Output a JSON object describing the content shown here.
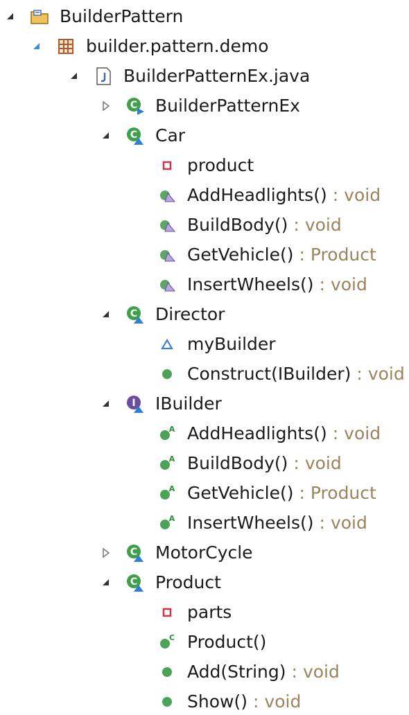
{
  "tree": {
    "nodes": [
      {
        "id": "project",
        "label": "BuilderPattern",
        "icon": "project-folder-icon",
        "expanded": true
      },
      {
        "id": "package",
        "label": "builder.pattern.demo",
        "icon": "package-icon",
        "expanded": true
      },
      {
        "id": "java_file",
        "label": "BuilderPatternEx.java",
        "icon": "java-file-icon",
        "expanded": true
      },
      {
        "id": "builderpatternex",
        "label": "BuilderPatternEx",
        "icon": "runnable-class-icon",
        "expanded": false
      },
      {
        "id": "car",
        "label": "Car",
        "icon": "class-icon",
        "expanded": true
      },
      {
        "id": "car_product",
        "label": "product",
        "icon": "private-field-icon"
      },
      {
        "id": "car_addheadlights",
        "label": "AddHeadlights()",
        "type": "void",
        "icon": "method-icon"
      },
      {
        "id": "car_buildbody",
        "label": "BuildBody()",
        "type": "void",
        "icon": "method-icon"
      },
      {
        "id": "car_getvehicle",
        "label": "GetVehicle()",
        "type": "Product",
        "icon": "method-icon"
      },
      {
        "id": "car_insertwheels",
        "label": "InsertWheels()",
        "type": "void",
        "icon": "method-icon"
      },
      {
        "id": "director",
        "label": "Director",
        "icon": "class-icon",
        "expanded": true
      },
      {
        "id": "director_mybuilder",
        "label": "myBuilder",
        "icon": "default-field-icon"
      },
      {
        "id": "director_construct",
        "label": "Construct(IBuilder)",
        "type": "void",
        "icon": "public-method-icon"
      },
      {
        "id": "ibuilder",
        "label": "IBuilder",
        "icon": "interface-icon",
        "expanded": true
      },
      {
        "id": "ib_addheadlights",
        "label": "AddHeadlights()",
        "type": "void",
        "icon": "abstract-method-icon"
      },
      {
        "id": "ib_buildbody",
        "label": "BuildBody()",
        "type": "void",
        "icon": "abstract-method-icon"
      },
      {
        "id": "ib_getvehicle",
        "label": "GetVehicle()",
        "type": "Product",
        "icon": "abstract-method-icon"
      },
      {
        "id": "ib_insertwheels",
        "label": "InsertWheels()",
        "type": "void",
        "icon": "abstract-method-icon"
      },
      {
        "id": "motorcycle",
        "label": "MotorCycle",
        "icon": "class-icon",
        "expanded": false
      },
      {
        "id": "product",
        "label": "Product",
        "icon": "class-icon",
        "expanded": true
      },
      {
        "id": "product_parts",
        "label": "parts",
        "icon": "private-field-icon"
      },
      {
        "id": "product_ctor",
        "label": "Product()",
        "icon": "constructor-icon"
      },
      {
        "id": "product_add",
        "label": "Add(String)",
        "type": "void",
        "icon": "public-method-icon"
      },
      {
        "id": "product_show",
        "label": "Show()",
        "type": "void",
        "icon": "public-method-icon"
      }
    ]
  },
  "ui": {
    "separator": ":"
  },
  "colors": {
    "type_text": "#9b835c",
    "label_text": "#1a1a1a",
    "class_green": "#2b8f3e",
    "interface_purple": "#6a4ca0",
    "field_red": "#d2334a",
    "method_triangle": "#3c7ed8",
    "package_brown": "#b05a2a"
  }
}
